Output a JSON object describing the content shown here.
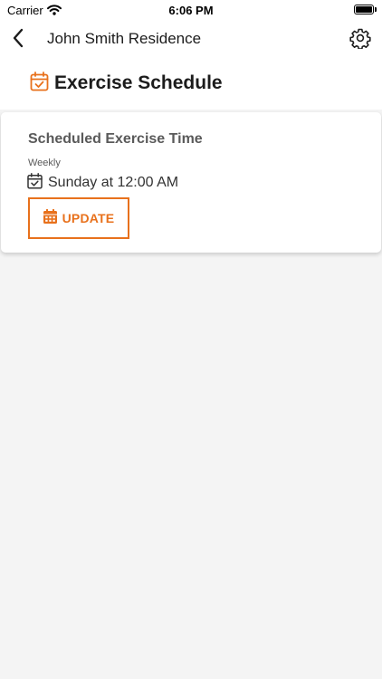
{
  "status_bar": {
    "carrier": "Carrier",
    "time": "6:06 PM",
    "battery_level": 1.0
  },
  "nav": {
    "title": "John Smith Residence",
    "back_icon": "chevron-left-icon",
    "settings_icon": "gear-icon"
  },
  "page": {
    "title": "Exercise Schedule",
    "title_icon": "calendar-check-icon"
  },
  "card": {
    "heading": "Scheduled Exercise Time",
    "frequency": "Weekly",
    "schedule_icon": "calendar-check-icon",
    "schedule_text": "Sunday at 12:00 AM",
    "update_label": "UPDATE",
    "update_icon": "calendar-icon"
  },
  "colors": {
    "accent": "#e8711c",
    "background": "#f4f4f4",
    "card": "#ffffff"
  }
}
